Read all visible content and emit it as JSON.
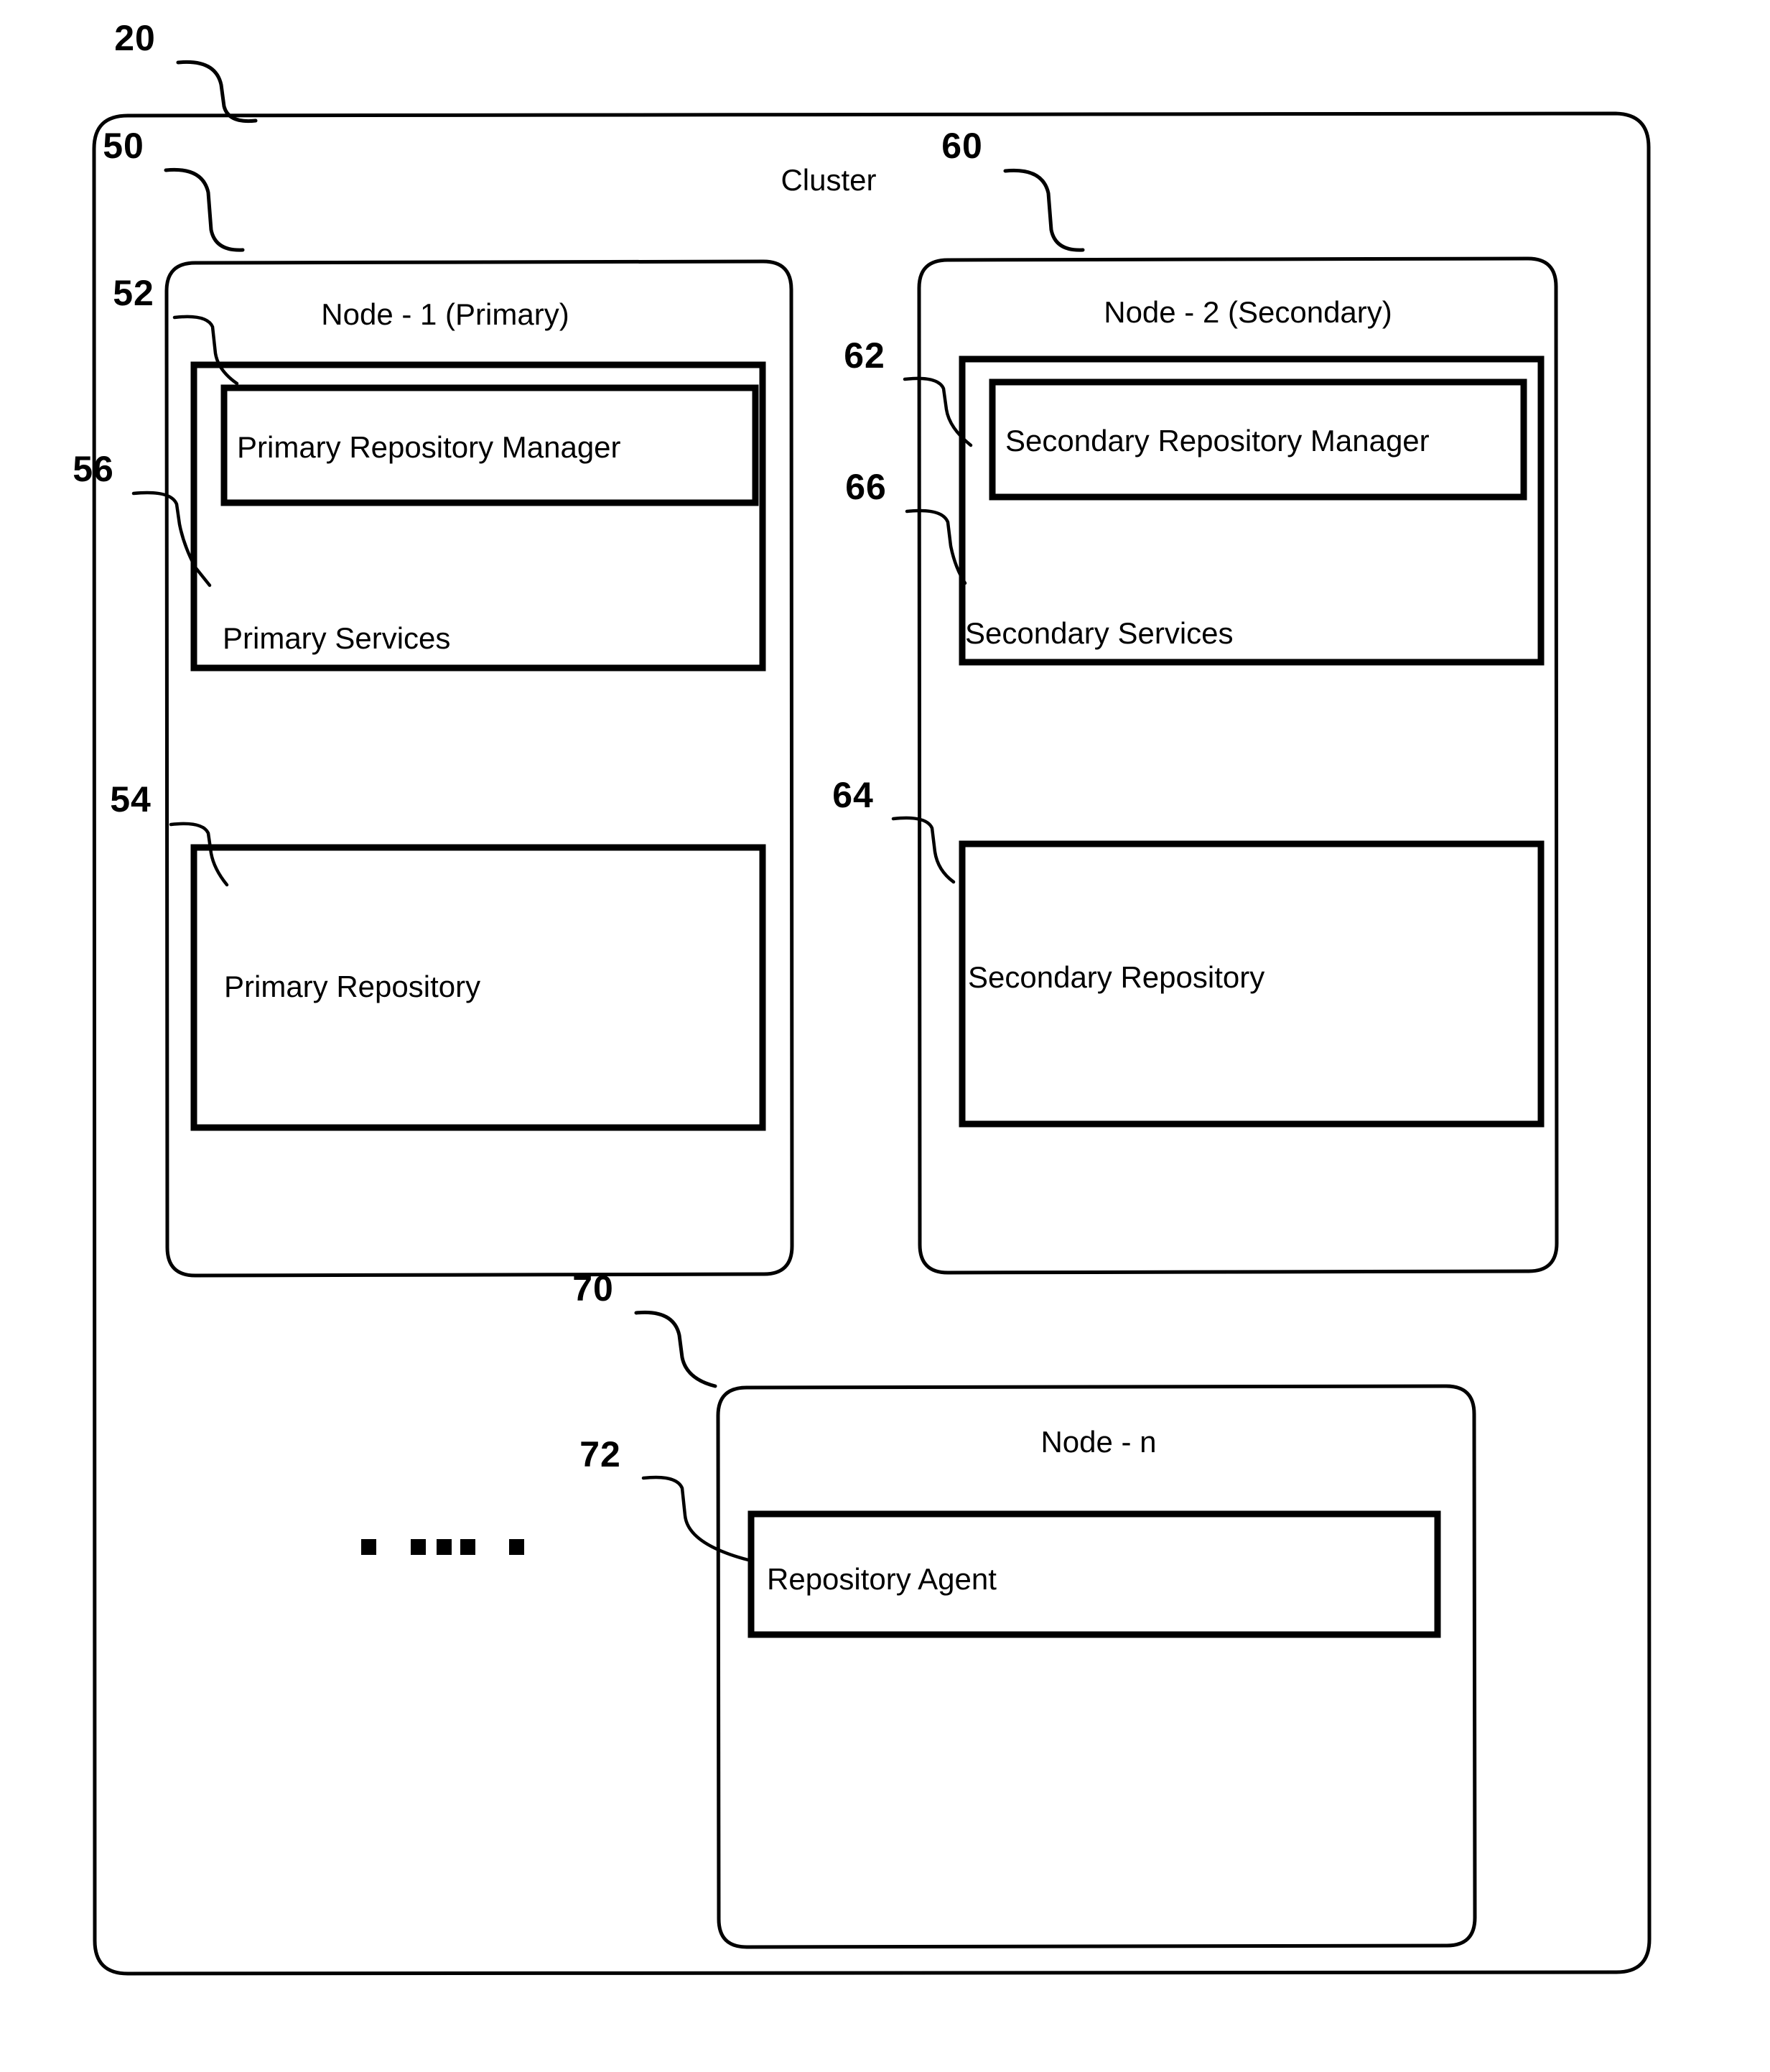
{
  "figure": {
    "cluster": {
      "label": "Cluster",
      "numeral": "20"
    },
    "nodes": [
      {
        "numeral": "50",
        "title": "Node - 1 (Primary)",
        "services": {
          "numeral": "56",
          "label": "Primary Services"
        },
        "manager": {
          "numeral": "52",
          "label": "Primary Repository Manager"
        },
        "repository": {
          "numeral": "54",
          "label": "Primary Repository"
        }
      },
      {
        "numeral": "60",
        "title": "Node - 2 (Secondary)",
        "services": {
          "numeral": "66",
          "label": "Secondary Services"
        },
        "manager": {
          "numeral": "62",
          "label": "Secondary Repository Manager"
        },
        "repository": {
          "numeral": "64",
          "label": "Secondary Repository"
        }
      },
      {
        "numeral": "70",
        "title": "Node - n",
        "agent": {
          "numeral": "72",
          "label": "Repository Agent"
        }
      }
    ],
    "ellipsis": {
      "name": "additional-nodes-ellipsis",
      "dot_count": 5
    },
    "colors": {
      "ink": "#000000",
      "paper": "#ffffff"
    }
  }
}
